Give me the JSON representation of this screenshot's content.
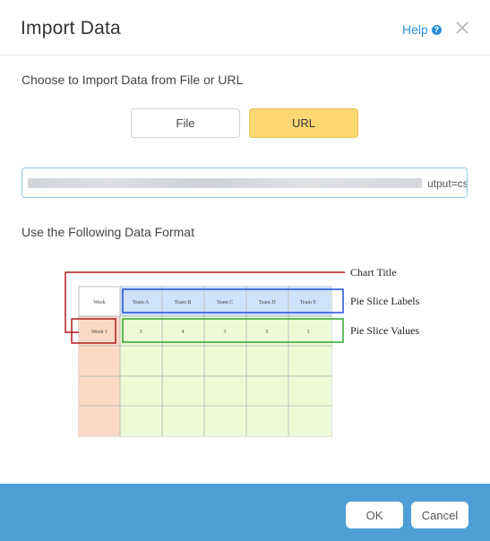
{
  "dialog": {
    "title": "Import Data",
    "help_label": "Help",
    "help_icon": "question-circle-icon",
    "close_icon": "close-icon"
  },
  "source": {
    "prompt": "Choose to Import Data from File or URL",
    "options": [
      "File",
      "URL"
    ],
    "selected": "URL",
    "url_visible_tail": "utput=csv"
  },
  "format": {
    "label": "Use the Following Data Format",
    "header_row": [
      "Week",
      "Team A",
      "Team B",
      "Team C",
      "Team D",
      "Team E"
    ],
    "value_row": [
      "Week 1",
      "3",
      "4",
      "3",
      "5",
      "3"
    ],
    "callouts": {
      "chart_title": "Chart Title",
      "slice_labels": "Pie Slice Labels",
      "slice_values": "Pie Slice Values"
    },
    "colors": {
      "title": "#b01c1c",
      "labels": "#1f4fd8",
      "values": "#2fa62f"
    }
  },
  "footer": {
    "ok_label": "OK",
    "cancel_label": "Cancel"
  },
  "colors": {
    "accent": "#2b8fd6",
    "footer": "#4d9fd6",
    "selected_toggle": "#fdd872"
  }
}
